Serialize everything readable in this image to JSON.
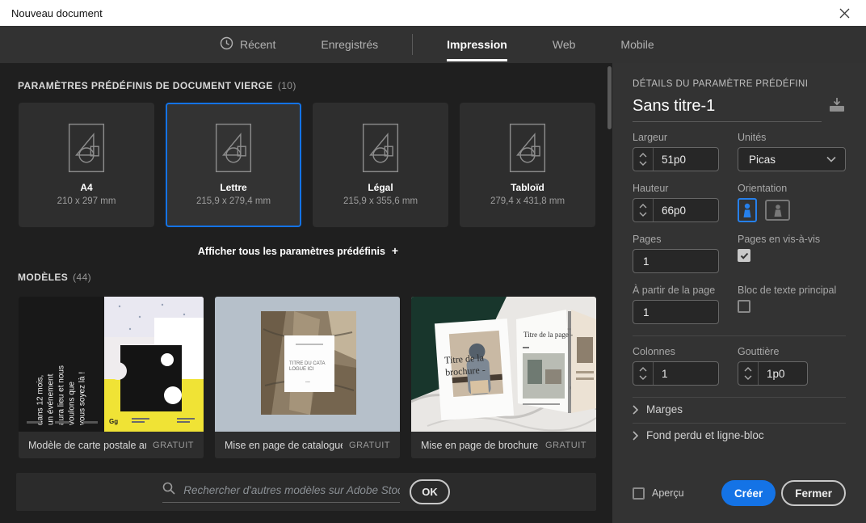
{
  "window": {
    "title": "Nouveau document"
  },
  "tabs": [
    {
      "label": "Récent"
    },
    {
      "label": "Enregistrés"
    },
    {
      "label": "Impression"
    },
    {
      "label": "Web"
    },
    {
      "label": "Mobile"
    }
  ],
  "presets": {
    "header": "PARAMÈTRES PRÉDÉFINIS DE DOCUMENT VIERGE",
    "count": "(10)",
    "items": [
      {
        "name": "A4",
        "dims": "210 x 297 mm"
      },
      {
        "name": "Lettre",
        "dims": "215,9 x 279,4 mm"
      },
      {
        "name": "Légal",
        "dims": "215,9 x 355,6 mm"
      },
      {
        "name": "Tabloïd",
        "dims": "279,4 x 431,8 mm"
      }
    ],
    "show_all": "Afficher tous les paramètres prédéfinis",
    "show_all_plus": "+"
  },
  "templates": {
    "header": "MODÈLES",
    "count": "(44)",
    "items": [
      {
        "label": "Modèle de carte postale amu...",
        "badge": "GRATUIT"
      },
      {
        "label": "Mise en page de catalogue c...",
        "badge": "GRATUIT"
      },
      {
        "label": "Mise en page de brochure pa...",
        "badge": "GRATUIT"
      }
    ],
    "postcard_lines": [
      "dans 12 mois,",
      "un événement",
      "aura lieu et nous",
      "voulons que",
      "vous soyez là !"
    ],
    "postcard_logo": "Gg",
    "catalogue_title_1": "TITRE DU CATA",
    "catalogue_title_2": "LOGUE ICI",
    "catalogue_dots": "...",
    "brochure_cover_1": "Titre de la",
    "brochure_cover_2": "brochure -",
    "brochure_page_title": "Titre de la page -"
  },
  "search": {
    "placeholder": "Rechercher d'autres modèles sur Adobe Stock",
    "ok_label": "OK"
  },
  "details": {
    "header": "DÉTAILS DU PARAMÈTRE PRÉDÉFINI",
    "doc_name": "Sans titre-1",
    "largeur": {
      "label": "Largeur",
      "value": "51p0"
    },
    "unites": {
      "label": "Unités",
      "value": "Picas"
    },
    "hauteur": {
      "label": "Hauteur",
      "value": "66p0"
    },
    "orientation": {
      "label": "Orientation"
    },
    "pages": {
      "label": "Pages",
      "value": "1"
    },
    "facing_pages": {
      "label": "Pages en vis-à-vis",
      "checked": true
    },
    "start_page": {
      "label": "À partir de la page",
      "value": "1"
    },
    "primary_text_frame": {
      "label": "Bloc de texte principal",
      "checked": false
    },
    "colonnes": {
      "label": "Colonnes",
      "value": "1"
    },
    "gouttiere": {
      "label": "Gouttière",
      "value": "1p0"
    },
    "marges_label": "Marges",
    "bleed_label": "Fond perdu et ligne-bloc"
  },
  "footer": {
    "apercu_label": "Aperçu",
    "create_label": "Créer",
    "close_label": "Fermer"
  },
  "colors": {
    "accent": "#1473e6",
    "panel": "#333333",
    "content_bg": "#1f1f1f",
    "card_bg": "#2e2e2e",
    "yellow": "#f0e335",
    "green": "#18362c"
  }
}
